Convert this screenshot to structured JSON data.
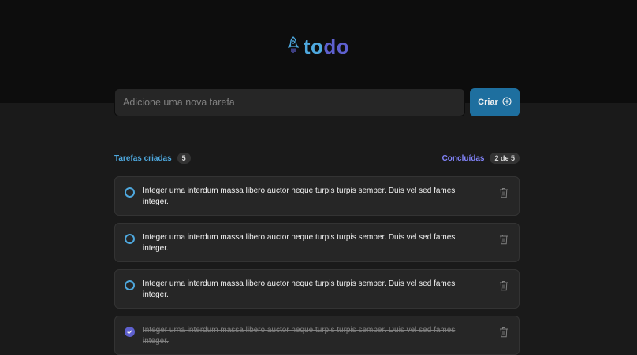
{
  "app": {
    "logo_icon": "rocket-icon",
    "title_part1": "to",
    "title_part2": "do"
  },
  "new_task": {
    "placeholder": "Adicione uma nova tarefa",
    "create_label": "Criar",
    "create_icon": "plus-circle-icon"
  },
  "counters": {
    "created_label": "Tarefas criadas",
    "created_count": "5",
    "done_label": "Concluídas",
    "done_count": "2 de 5"
  },
  "tasks": [
    {
      "text": "Integer urna interdum massa libero auctor neque turpis turpis semper. Duis vel sed fames integer.",
      "done": false
    },
    {
      "text": "Integer urna interdum massa libero auctor neque turpis turpis semper. Duis vel sed fames integer.",
      "done": false
    },
    {
      "text": "Integer urna interdum massa libero auctor neque turpis turpis semper. Duis vel sed fames integer.",
      "done": false
    },
    {
      "text": "Integer urna interdum massa libero auctor neque turpis turpis semper. Duis vel sed fames integer.",
      "done": true
    }
  ],
  "colors": {
    "header_bg": "#0d0d0d",
    "page_bg": "#1a1a1a",
    "blue": "#4ea8de",
    "blue_dark": "#1e6f9f",
    "purple": "#5e60ce",
    "purple_light": "#8284fa"
  }
}
